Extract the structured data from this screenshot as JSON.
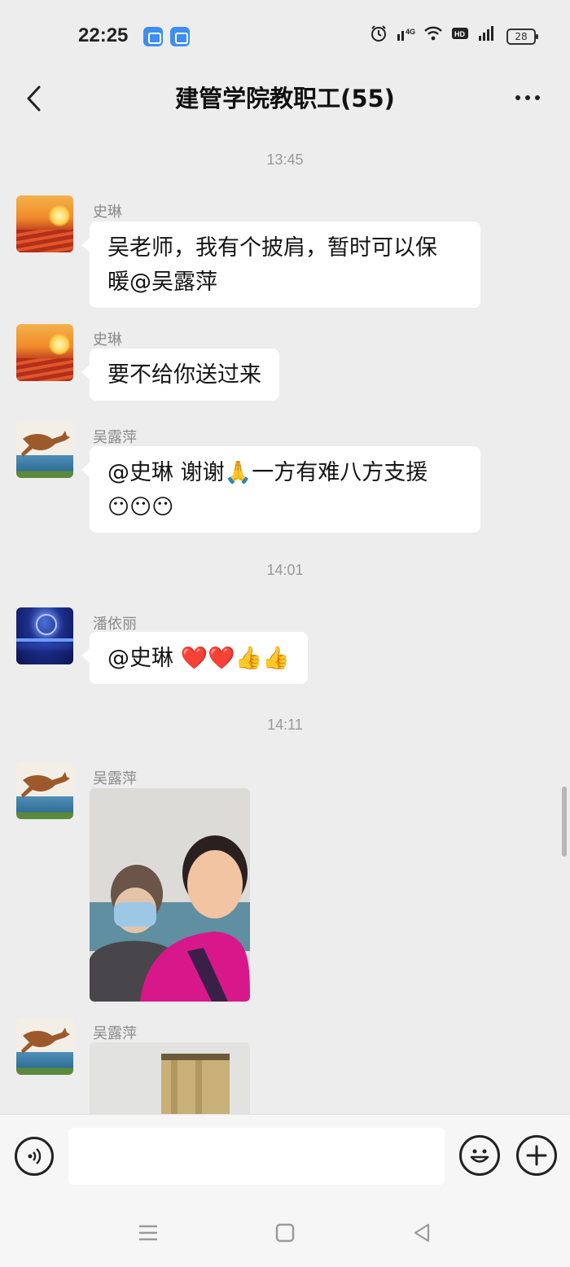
{
  "status_bar": {
    "time": "22:25",
    "icons": [
      "alarm-icon",
      "signal-hd-icon",
      "wifi-icon",
      "hd-icon",
      "cellular-icon"
    ],
    "battery": "28"
  },
  "header": {
    "title": "建管学院教职工(55)",
    "back_icon": "chevron-left-icon",
    "more_icon": "ellipsis-icon"
  },
  "messages": {
    "time_1": "13:45",
    "msg_1": {
      "sender": "史琳",
      "text_line1": "吴老师，我有个披肩，暂时可以保",
      "text_line2": "暖@吴露萍"
    },
    "msg_2": {
      "sender": "史琳",
      "text": "要不给你送过来"
    },
    "msg_3": {
      "sender": "吴露萍",
      "text_line1": "@史琳  谢谢🙏一方有难八方支援",
      "text_line2": "😶😶😶"
    },
    "time_2": "14:01",
    "msg_4": {
      "sender": "潘依丽",
      "text": "@史琳  ❤️❤️👍👍"
    },
    "time_3": "14:11",
    "msg_5": {
      "sender": "吴露萍",
      "type": "image"
    },
    "msg_6": {
      "sender": "吴露萍",
      "type": "image"
    }
  },
  "input_bar": {
    "value": "",
    "voice_icon": "voice-icon",
    "emoji_icon": "smiley-icon",
    "plus_icon": "plus-icon"
  },
  "nav_bar": {
    "icons": [
      "menu-icon",
      "home-square-icon",
      "back-triangle-icon"
    ]
  }
}
